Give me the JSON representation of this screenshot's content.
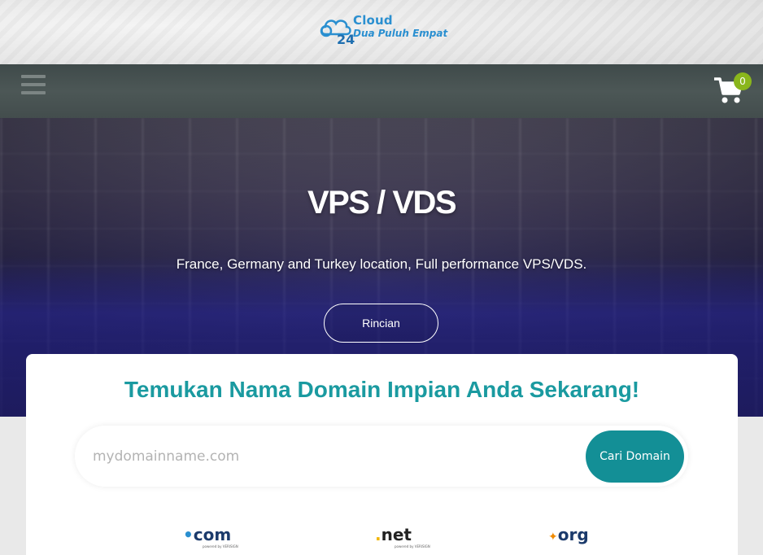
{
  "header": {
    "logo_primary": "Cloud",
    "logo_secondary": "Dua Puluh Empat",
    "logo_mark": "24"
  },
  "navbar": {
    "menu_icon": "hamburger-menu-icon",
    "cart_icon": "shopping-cart-icon",
    "cart_count": "0"
  },
  "hero": {
    "title": "VPS / VDS",
    "subtitle": "France, Germany and Turkey location, Full performance VPS/VDS.",
    "button_label": "Rincian"
  },
  "domain_search": {
    "title": "Temukan Nama Domain Impian Anda Sekarang!",
    "placeholder": "mydomainname.com",
    "button_label": "Cari Domain",
    "tlds": [
      {
        "dot": "•",
        "name": "com",
        "powered": "powered by VERISIGN"
      },
      {
        "dot": ".",
        "name": "net",
        "powered": "powered by VERISIGN"
      },
      {
        "dot": "✦",
        "name": "org",
        "powered": ""
      }
    ]
  },
  "colors": {
    "accent": "#138f96",
    "title_teal": "#1a9aa0",
    "badge_green": "#8ab61c",
    "logo_blue": "#2a8fd0"
  }
}
